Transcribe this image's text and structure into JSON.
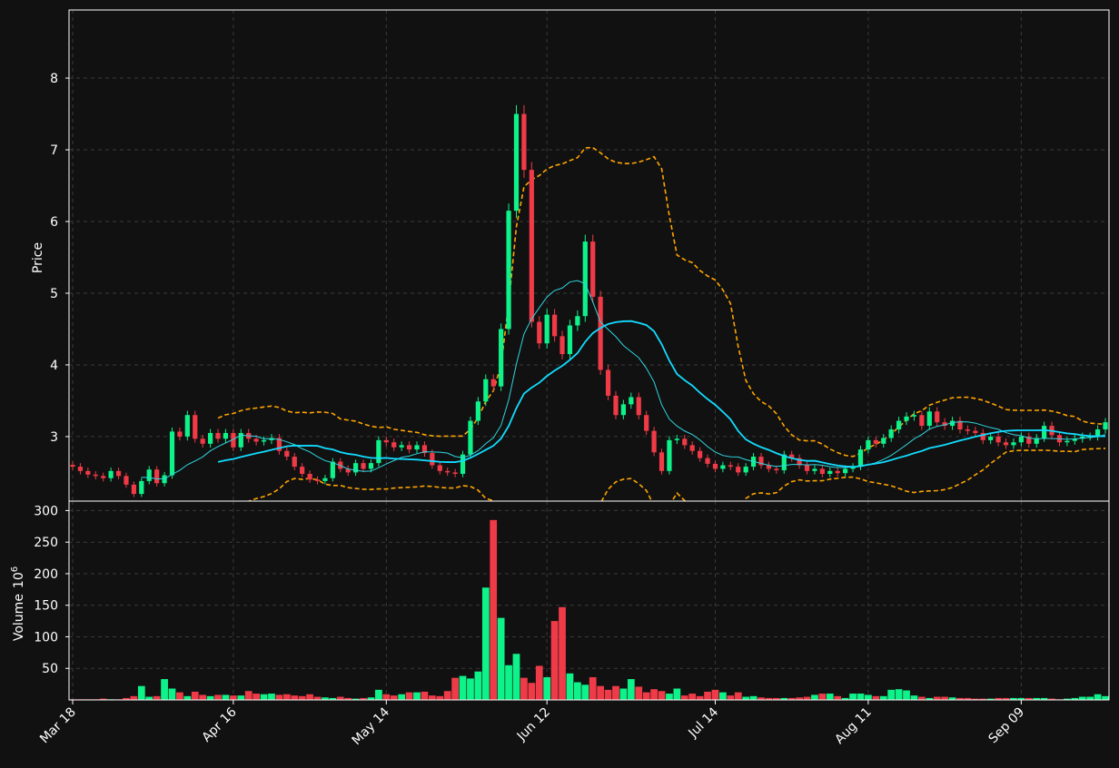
{
  "chart_data": {
    "type": "candlestick",
    "panels": {
      "price": {
        "ylabel": "Price",
        "yticks": [
          3,
          4,
          5,
          6,
          7,
          8
        ],
        "ylim": [
          2.1,
          8.95
        ]
      },
      "volume": {
        "ylabel": "Volume",
        "ylabel_exp": "6",
        "yticks": [
          50,
          100,
          150,
          200,
          250,
          300
        ],
        "ylim": [
          0,
          315
        ]
      }
    },
    "xtick_labels": [
      "Mar 18",
      "Apr 16",
      "May 14",
      "Jun 12",
      "Jul 14",
      "Aug 11",
      "Sep 09"
    ],
    "xtick_index": [
      0,
      21,
      41,
      62,
      84,
      104,
      124
    ],
    "grid": true,
    "colors": {
      "up": "#0ef28a",
      "down": "#ef3a47",
      "sma_short": "#2fd6e0",
      "sma_long": "#12dcff",
      "band": "#ffa500",
      "background": "#111111",
      "grid": "#3a3a3a",
      "axis": "#ffffff"
    },
    "close": [
      2.58,
      2.52,
      2.47,
      2.45,
      2.42,
      2.52,
      2.45,
      2.33,
      2.2,
      2.38,
      2.54,
      2.35,
      2.46,
      3.07,
      3.0,
      3.3,
      2.97,
      2.9,
      3.05,
      2.97,
      3.05,
      2.85,
      3.05,
      2.97,
      2.93,
      2.95,
      2.98,
      2.8,
      2.72,
      2.58,
      2.48,
      2.4,
      2.38,
      2.42,
      2.65,
      2.55,
      2.5,
      2.63,
      2.55,
      2.63,
      2.95,
      2.92,
      2.85,
      2.88,
      2.82,
      2.88,
      2.77,
      2.6,
      2.52,
      2.5,
      2.48,
      2.75,
      3.22,
      3.49,
      3.8,
      3.7,
      4.5,
      6.15,
      7.5,
      6.72,
      4.6,
      4.3,
      4.7,
      4.4,
      4.15,
      4.55,
      4.68,
      5.72,
      4.95,
      3.93,
      3.57,
      3.3,
      3.45,
      3.55,
      3.3,
      3.08,
      2.78,
      2.52,
      2.95,
      2.97,
      2.88,
      2.8,
      2.7,
      2.62,
      2.55,
      2.6,
      2.58,
      2.5,
      2.58,
      2.72,
      2.6,
      2.55,
      2.53,
      2.75,
      2.7,
      2.6,
      2.52,
      2.55,
      2.48,
      2.52,
      2.49,
      2.55,
      2.58,
      2.82,
      2.95,
      2.9,
      2.98,
      3.1,
      3.22,
      3.28,
      3.3,
      3.15,
      3.35,
      3.2,
      3.15,
      3.22,
      3.1,
      3.08,
      3.05,
      2.95,
      3.0,
      2.92,
      2.88,
      2.92,
      3.0,
      2.9,
      2.98,
      3.15,
      3.02,
      2.92,
      2.94,
      2.97,
      3.0,
      3.0,
      3.1,
      3.2
    ],
    "volume": [
      1,
      1,
      1,
      1,
      2,
      1,
      1,
      3,
      6,
      22,
      5,
      6,
      33,
      18,
      12,
      6,
      13,
      8,
      6,
      8,
      8,
      7,
      7,
      14,
      10,
      9,
      10,
      8,
      9,
      7,
      6,
      9,
      5,
      4,
      3,
      5,
      3,
      2,
      3,
      4,
      16,
      9,
      7,
      9,
      12,
      12,
      13,
      7,
      6,
      14,
      35,
      38,
      34,
      45,
      178,
      285,
      130,
      55,
      73,
      35,
      27,
      54,
      36,
      125,
      147,
      42,
      28,
      24,
      36,
      22,
      16,
      22,
      18,
      33,
      21,
      12,
      17,
      14,
      10,
      18,
      7,
      10,
      6,
      13,
      16,
      12,
      7,
      12,
      5,
      6,
      4,
      3,
      3,
      3,
      3,
      4,
      5,
      8,
      10,
      10,
      6,
      3,
      10,
      10,
      8,
      6,
      6,
      16,
      17,
      15,
      7,
      5,
      3,
      5,
      5,
      4,
      3,
      3,
      2,
      2,
      2,
      3,
      3,
      3,
      3,
      3,
      3,
      3,
      2,
      1,
      2,
      3,
      5,
      5,
      9,
      6
    ]
  }
}
